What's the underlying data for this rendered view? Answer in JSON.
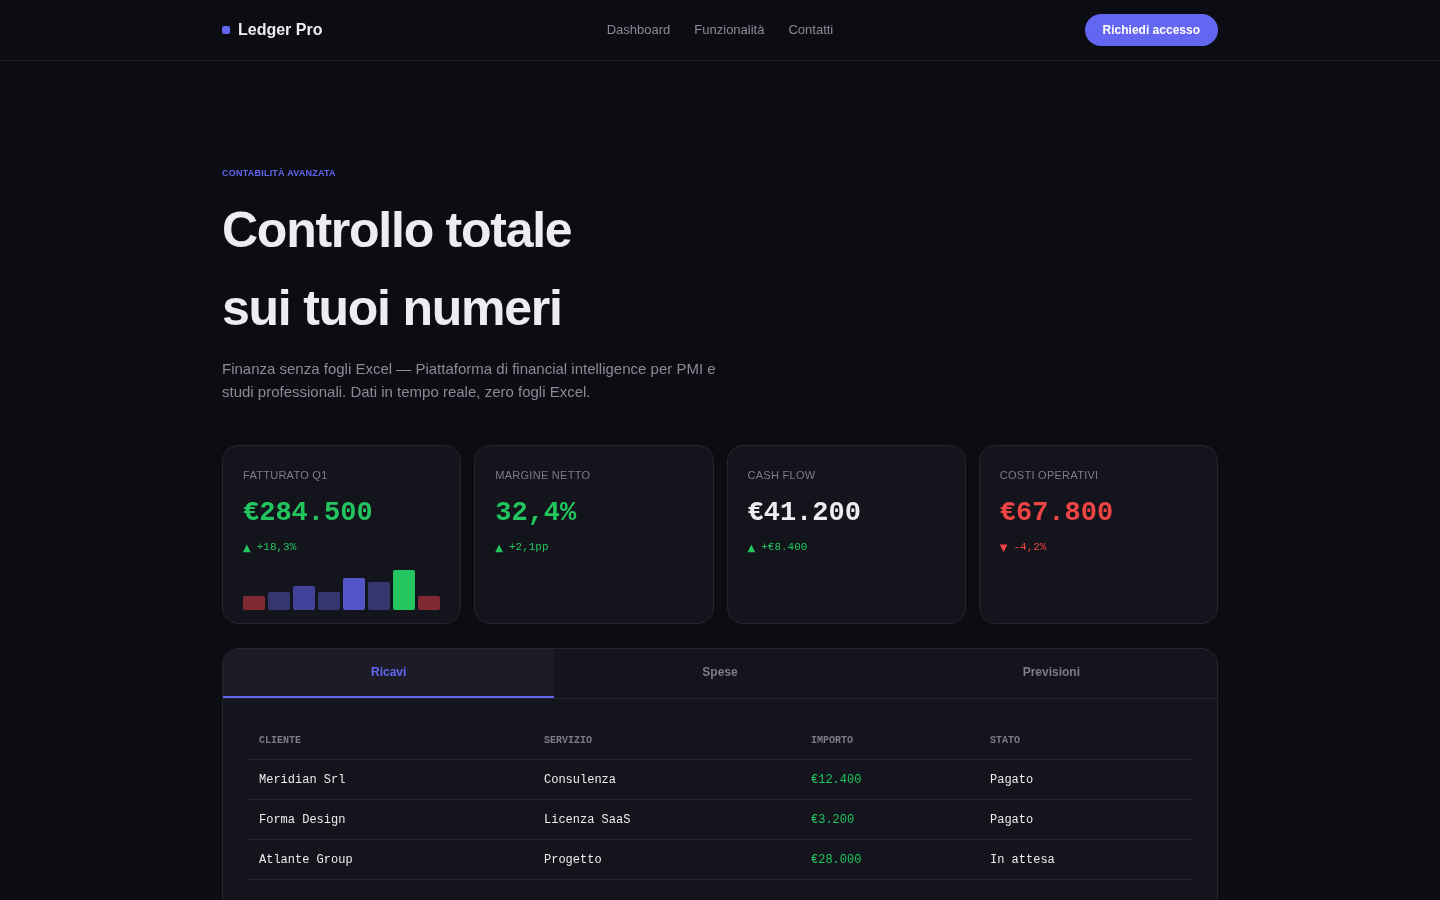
{
  "nav": {
    "brand": "Ledger Pro",
    "links": [
      "Dashboard",
      "Funzionalità",
      "Contatti"
    ],
    "cta": "Richiedi accesso"
  },
  "hero": {
    "eyebrow": "CONTABILITÀ AVANZATA",
    "title_lines": [
      "Controllo totale",
      "sui tuoi numeri"
    ],
    "subtitle": "Finanza senza fogli Excel — Piattaforma di financial intelligence per PMI e studi professionali. Dati in tempo reale, zero fogli Excel."
  },
  "kpis": [
    {
      "label": "FATTURATO Q1",
      "value": "€284.500",
      "color": "#22c55e",
      "delta": {
        "arrow": "▲",
        "text": "+18,3%",
        "color": "#22c55e"
      },
      "sparkbars": true
    },
    {
      "label": "MARGINE NETTO",
      "value": "32,4%",
      "color": "#22c55e",
      "delta": {
        "arrow": "▲",
        "text": "+2,1pp",
        "color": "#22c55e"
      },
      "sparkbars": false
    },
    {
      "label": "CASH FLOW",
      "value": "€41.200",
      "color": "#ececf1",
      "delta": {
        "arrow": "▲",
        "text": "+€8.400",
        "color": "#22c55e"
      },
      "sparkbars": false
    },
    {
      "label": "COSTI OPERATIVI",
      "value": "€67.800",
      "color": "#ef4444",
      "delta": {
        "arrow": "▼",
        "text": "-4,2%",
        "color": "#ef4444"
      },
      "sparkbars": false
    }
  ],
  "tabs": [
    {
      "label": "Ricavi",
      "selected": true
    },
    {
      "label": "Spese",
      "selected": false
    },
    {
      "label": "Previsioni",
      "selected": false
    }
  ],
  "table": {
    "columns": [
      "CLIENTE",
      "SERVIZIO",
      "IMPORTO",
      "STATO"
    ],
    "rows": [
      [
        "Meridian Srl",
        "Consulenza",
        "€12.400",
        "Pagato"
      ],
      [
        "Forma Design",
        "Licenza SaaS",
        "€3.200",
        "Pagato"
      ],
      [
        "Atlante Group",
        "Progetto",
        "€28.000",
        "In attesa"
      ]
    ]
  }
}
